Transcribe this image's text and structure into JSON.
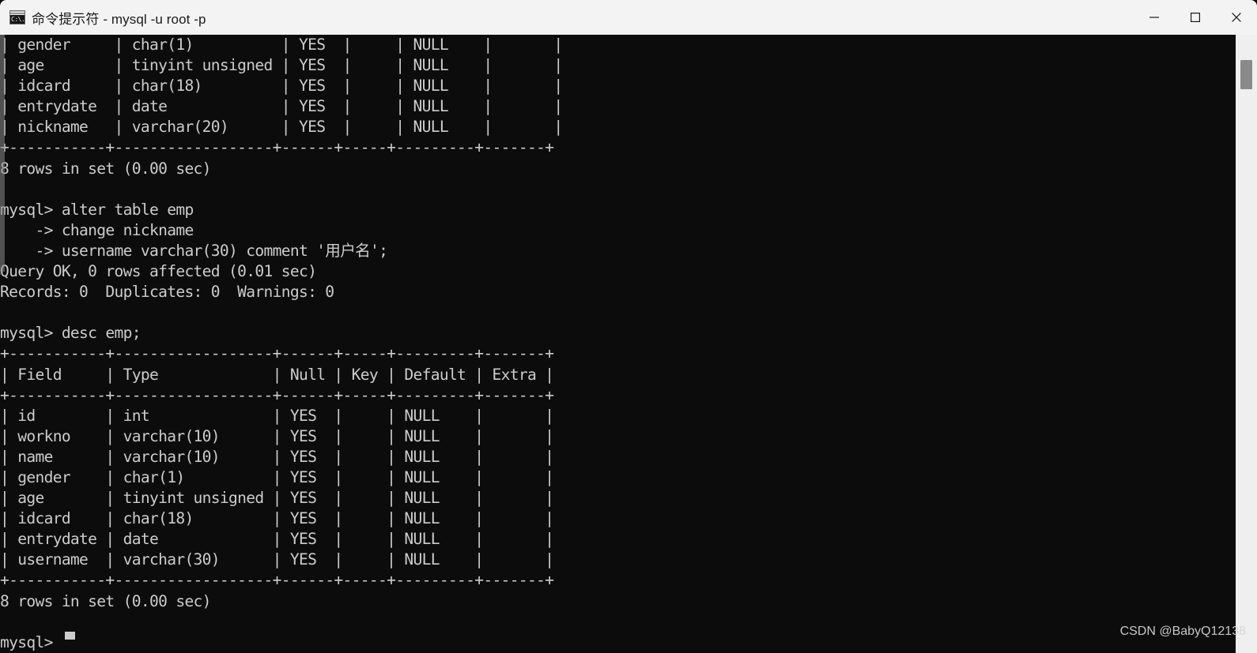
{
  "window": {
    "title": "命令提示符 - mysql  -u root -p",
    "app_icon": "command-prompt-icon",
    "icon_text": "C:\\.",
    "background_color": "#0c0c0c",
    "text_color": "#cccccc",
    "titlebar_color": "#f3f3f3",
    "controls": {
      "minimize": "minimize-icon",
      "maximize": "maximize-icon",
      "close": "close-icon"
    }
  },
  "terminal": {
    "prompt": "mysql>",
    "continuation_prompt": "    ->",
    "cursor": "block-cursor",
    "lines": [
      "| gender     | char(1)          | YES  |     | NULL    |       |",
      "| age        | tinyint unsigned | YES  |     | NULL    |       |",
      "| idcard     | char(18)         | YES  |     | NULL    |       |",
      "| entrydate  | date             | YES  |     | NULL    |       |",
      "| nickname   | varchar(20)      | YES  |     | NULL    |       |",
      "+-----------+------------------+------+-----+---------+-------+",
      "8 rows in set (0.00 sec)",
      "",
      "mysql> alter table emp",
      "    -> change nickname",
      "    -> username varchar(30) comment '用户名';",
      "Query OK, 0 rows affected (0.01 sec)",
      "Records: 0  Duplicates: 0  Warnings: 0",
      "",
      "mysql> desc emp;",
      "+-----------+------------------+------+-----+---------+-------+",
      "| Field     | Type             | Null | Key | Default | Extra |",
      "+-----------+------------------+------+-----+---------+-------+",
      "| id        | int              | YES  |     | NULL    |       |",
      "| workno    | varchar(10)      | YES  |     | NULL    |       |",
      "| name      | varchar(10)      | YES  |     | NULL    |       |",
      "| gender    | char(1)          | YES  |     | NULL    |       |",
      "| age       | tinyint unsigned | YES  |     | NULL    |       |",
      "| idcard    | char(18)         | YES  |     | NULL    |       |",
      "| entrydate | date             | YES  |     | NULL    |       |",
      "| username  | varchar(30)      | YES  |     | NULL    |       |",
      "+-----------+------------------+------+-----+---------+-------+",
      "8 rows in set (0.00 sec)",
      "",
      "mysql> "
    ],
    "commands": [
      "alter table emp change nickname username varchar(30) comment '用户名';",
      "desc emp;"
    ],
    "result_messages": [
      "8 rows in set (0.00 sec)",
      "Query OK, 0 rows affected (0.01 sec)",
      "Records: 0  Duplicates: 0  Warnings: 0",
      "8 rows in set (0.00 sec)"
    ],
    "desc_table": {
      "headers": [
        "Field",
        "Type",
        "Null",
        "Key",
        "Default",
        "Extra"
      ],
      "rows": [
        [
          "id",
          "int",
          "YES",
          "",
          "NULL",
          ""
        ],
        [
          "workno",
          "varchar(10)",
          "YES",
          "",
          "NULL",
          ""
        ],
        [
          "name",
          "varchar(10)",
          "YES",
          "",
          "NULL",
          ""
        ],
        [
          "gender",
          "char(1)",
          "YES",
          "",
          "NULL",
          ""
        ],
        [
          "age",
          "tinyint unsigned",
          "YES",
          "",
          "NULL",
          ""
        ],
        [
          "idcard",
          "char(18)",
          "YES",
          "",
          "NULL",
          ""
        ],
        [
          "entrydate",
          "date",
          "YES",
          "",
          "NULL",
          ""
        ],
        [
          "username",
          "varchar(30)",
          "YES",
          "",
          "NULL",
          ""
        ]
      ],
      "row_count_text": "8 rows in set (0.00 sec)"
    },
    "previous_table_partial_rows": [
      [
        "gender",
        "char(1)",
        "YES",
        "",
        "NULL",
        ""
      ],
      [
        "age",
        "tinyint unsigned",
        "YES",
        "",
        "NULL",
        ""
      ],
      [
        "idcard",
        "char(18)",
        "YES",
        "",
        "NULL",
        ""
      ],
      [
        "entrydate",
        "date",
        "YES",
        "",
        "NULL",
        ""
      ],
      [
        "nickname",
        "varchar(20)",
        "YES",
        "",
        "NULL",
        ""
      ]
    ]
  },
  "scrollbar": {
    "name": "vertical-scrollbar",
    "thumb": "scrollbar-thumb"
  },
  "watermark": {
    "text": "CSDN @BabyQ12138"
  }
}
